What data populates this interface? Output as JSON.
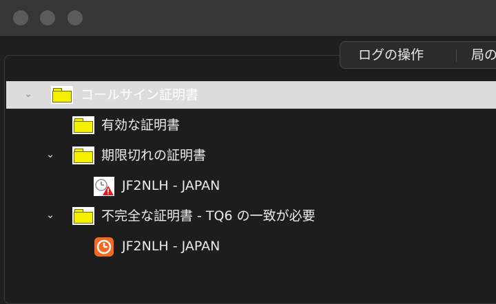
{
  "window": {
    "tabs": [
      {
        "label": "ログの操作"
      },
      {
        "label": "局の"
      }
    ]
  },
  "tree": {
    "items": [
      {
        "label": "コールサイン証明書",
        "icon": "folder-icon",
        "expanded": true,
        "selected": true
      },
      {
        "label": "有効な証明書",
        "icon": "folder-icon",
        "expanded": false,
        "selected": false
      },
      {
        "label": "期限切れの証明書",
        "icon": "folder-icon",
        "expanded": true,
        "selected": false
      },
      {
        "label": "JF2NLH - JAPAN",
        "icon": "certificate-warning-icon",
        "selected": false
      },
      {
        "label": "不完全な証明書 - TQ6 の一致が必要",
        "icon": "folder-icon",
        "expanded": true,
        "selected": false
      },
      {
        "label": "JF2NLH - JAPAN",
        "icon": "clock-icon",
        "selected": false
      }
    ]
  },
  "colors": {
    "selected_row": "#dcdcdc",
    "folder_yellow": "#f5f000",
    "clock_orange": "#f06a1f",
    "warning_red": "#d61f1f"
  }
}
